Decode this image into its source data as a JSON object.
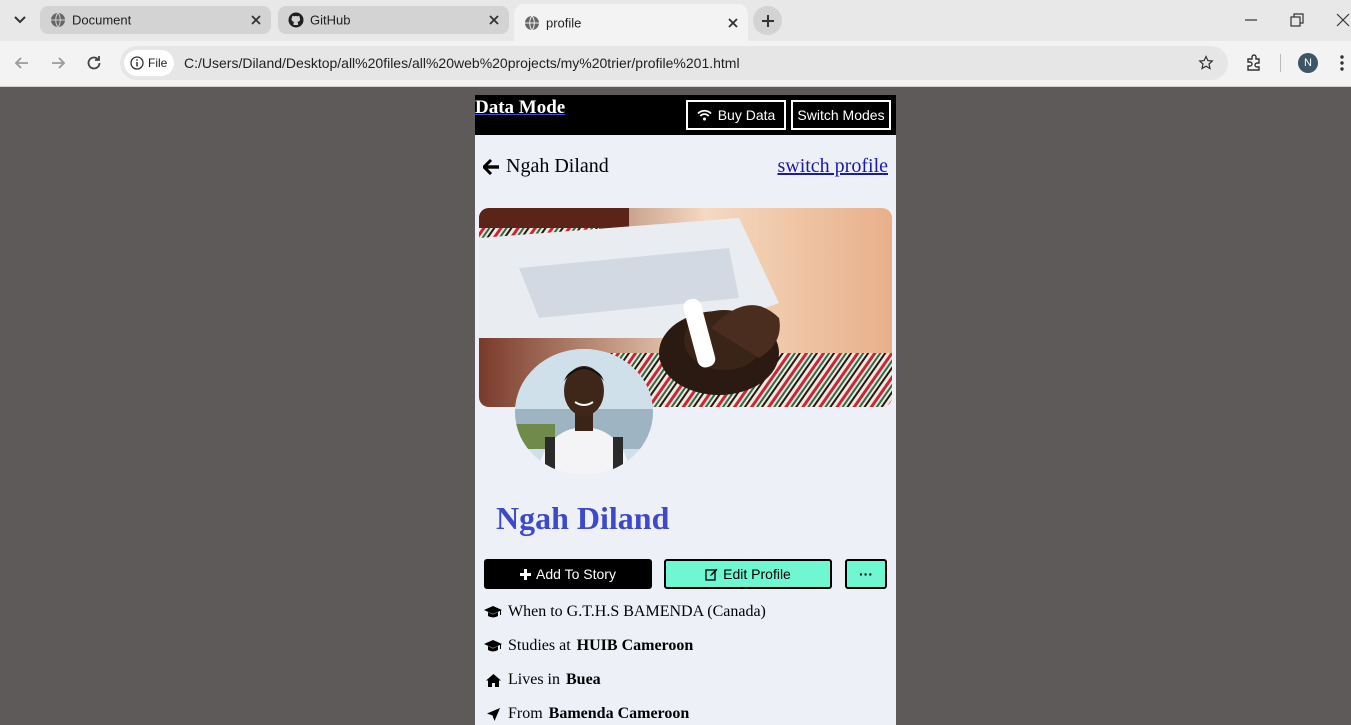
{
  "browser": {
    "tabs": [
      {
        "label": "Document",
        "active": false
      },
      {
        "label": "GitHub",
        "active": false
      },
      {
        "label": "profile",
        "active": true
      }
    ],
    "file_chip": "File",
    "url": "C:/Users/Diland/Desktop/all%20files/all%20web%20projects/my%20trier/profile%201.html",
    "profile_initial": "N"
  },
  "header": {
    "brand": "Data Mode",
    "buy_data": "Buy Data",
    "switch_modes": "Switch Modes"
  },
  "profile": {
    "back_name": "Ngah Diland",
    "switch_profile": "switch profile",
    "name": "Ngah Diland"
  },
  "actions": {
    "add_story": "Add To Story",
    "edit_profile": "Edit Profile",
    "more": "···"
  },
  "info": {
    "school_prefix": "When to G.T.H.S BAMENDA (Canada)",
    "studies_prefix": "Studies at",
    "studies_value": "HUIB Cameroon",
    "lives_prefix": "Lives in",
    "lives_value": "Buea",
    "from_prefix": "From",
    "from_value": "Bamenda Cameroon"
  },
  "colors": {
    "page_bg": "#5e5a59",
    "panel_bg": "#eef0f8",
    "name_color": "#3e49c8",
    "edit_button": "#6ff7d2",
    "link": "#1a1aa6"
  }
}
